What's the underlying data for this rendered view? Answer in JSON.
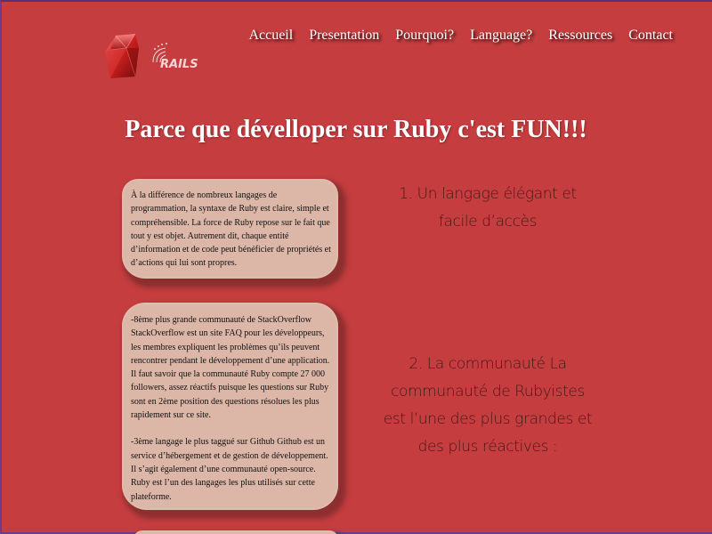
{
  "nav": {
    "items": [
      {
        "label": "Accueil"
      },
      {
        "label": "Presentation"
      },
      {
        "label": "Pourquoi?"
      },
      {
        "label": "Language?"
      },
      {
        "label": "Ressources"
      },
      {
        "label": "Contact"
      }
    ]
  },
  "logo": {
    "text": "RAILS"
  },
  "main": {
    "heading": "Parce que dévelloper sur Ruby c'est FUN!!!",
    "sections": [
      {
        "description": "À la différence de nombreux langages de programmation, la syntaxe de Ruby est claire, simple et compréhensible. La force de Ruby repose sur le fait que tout y est objet. Autrement dit, chaque entité d’information et de code peut bénéficier de propriétés et d’actions qui lui sont propres.",
        "point": "1. Un langage élégant et facile d’accès"
      },
      {
        "description_1": "-8ème plus grande communauté de StackOverflow StackOverflow est un site FAQ pour les développeurs, les membres expliquent les problèmes qu’ils peuvent rencontrer pendant le développement d’une application. Il faut savoir que la communauté Ruby compte 27 000 followers, assez réactifs puisque les questions sur Ruby sont en 2ème position des questions résolues les plus rapidement sur ce site.",
        "description_2": "-3ème langage le plus taggué sur Github Github est un service d’hébergement et de gestion de développement. Il s’agit également d’une communauté open-source. Ruby est l’un des langages les plus utilisés sur cette plateforme.",
        "point": "2. La communauté La communauté de Rubyistes est l’une des plus grandes et des plus réactives :"
      }
    ]
  },
  "colors": {
    "background": "#c53d3f",
    "bubble": "#dcb6a7",
    "nav_text": "#ffffff",
    "heading_text": "#ffffff",
    "point_text": "#3b1414"
  }
}
